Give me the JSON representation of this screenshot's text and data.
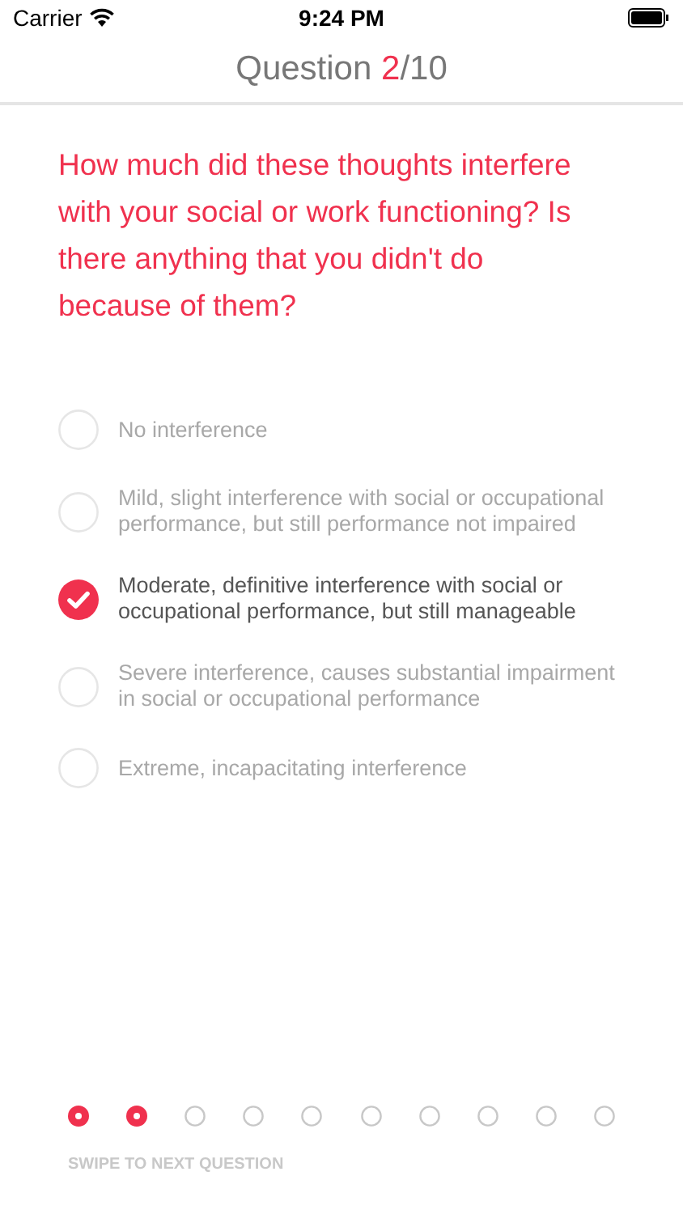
{
  "status_bar": {
    "carrier": "Carrier",
    "time": "9:24 PM"
  },
  "header": {
    "prefix": "Question ",
    "current": "2",
    "total": "/10"
  },
  "question": "How much did these thoughts interfere with your social or work functioning? Is there anything that you didn't do because of them?",
  "options": [
    {
      "label": "No interference",
      "selected": false
    },
    {
      "label": "Mild, slight interference with social or occupational performance, but still performance not impaired",
      "selected": false
    },
    {
      "label": "Moderate, definitive interference with social or occupational performance, but still manageable",
      "selected": true
    },
    {
      "label": "Severe interference, causes substantial impairment in social or occupational performance",
      "selected": false
    },
    {
      "label": "Extreme, incapacitating interference",
      "selected": false
    }
  ],
  "progress": [
    {
      "done": true
    },
    {
      "done": true
    },
    {
      "done": false
    },
    {
      "done": false
    },
    {
      "done": false
    },
    {
      "done": false
    },
    {
      "done": false
    },
    {
      "done": false
    },
    {
      "done": false
    },
    {
      "done": false
    }
  ],
  "hint": "SWIPE TO NEXT QUESTION"
}
